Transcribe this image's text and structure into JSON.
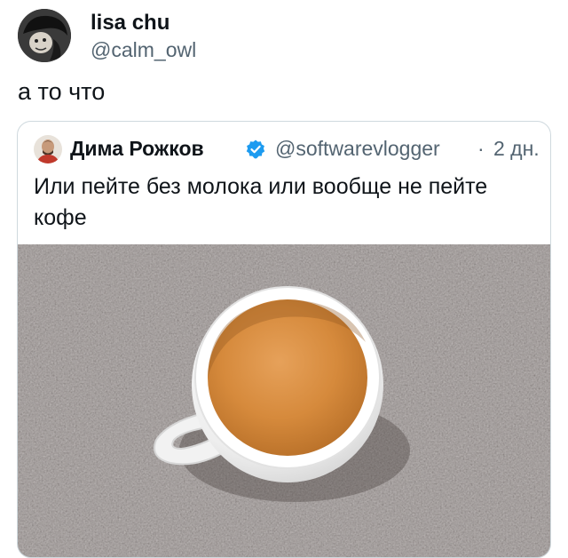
{
  "tweet": {
    "author": {
      "name": "lisa chu",
      "handle": "@calm_owl"
    },
    "text": "а то что"
  },
  "quote": {
    "author": {
      "name": "Дима Рожков",
      "handle": "@softwarevlogger",
      "separator": "·",
      "time": "2 дн."
    },
    "text": "Или пейте без молока или вообще не пейте кофе",
    "icons": {
      "verified": "verified-badge-icon"
    },
    "colors": {
      "verified": "#1d9bf0"
    }
  }
}
